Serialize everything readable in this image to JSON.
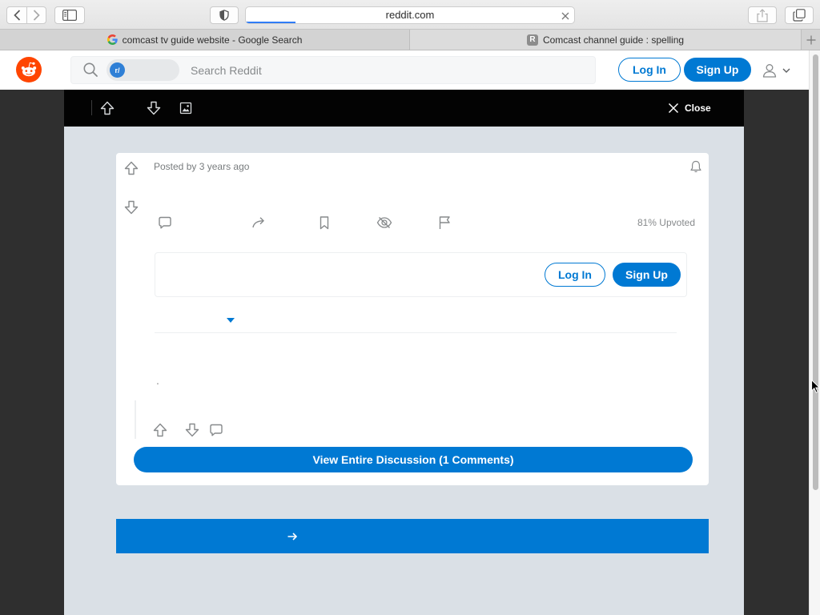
{
  "colors": {
    "accent": "#0079d3",
    "brand": "#ff4500"
  },
  "browser": {
    "address": "reddit.com",
    "load_progress": 0.15,
    "tabs": [
      {
        "title": "comcast tv guide website - Google Search",
        "icon": "google-favicon",
        "active": false
      },
      {
        "title": "Comcast channel guide : spelling",
        "icon": "reddit-favicon",
        "favicon_letter": "R",
        "active": true
      }
    ]
  },
  "header": {
    "logo_icon": "reddit-logo-icon",
    "search": {
      "scope_chip": "r/",
      "placeholder": "Search Reddit"
    },
    "login_label": "Log In",
    "signup_label": "Sign Up",
    "user_icon": "user-icon"
  },
  "overlay": {
    "bar_icons": [
      "upvote-icon",
      "downvote-icon",
      "image-icon"
    ],
    "close_label": "Close"
  },
  "post": {
    "posted_by_label": "Posted by",
    "time_ago": "3 years ago",
    "action_icons": [
      "comment-icon",
      "share-icon",
      "save-icon",
      "hide-icon",
      "report-icon"
    ],
    "upvote_ratio_label": "81% Upvoted",
    "login_prompt": {
      "login_label": "Log In",
      "signup_label": "Sign Up"
    },
    "comments": [
      {
        "body": "."
      }
    ],
    "view_discussion_label": "View Entire Discussion (1 Comments)"
  }
}
